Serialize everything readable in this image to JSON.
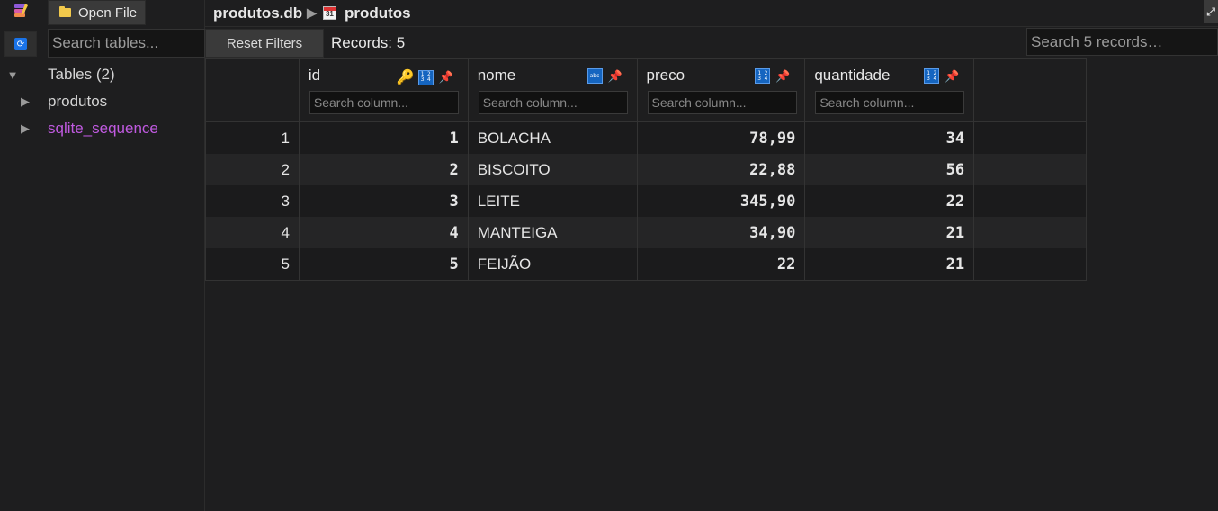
{
  "sidebar": {
    "open_file_label": "Open File",
    "search_placeholder": "Search tables...",
    "tables_label": "Tables (2)",
    "tables": [
      {
        "name": "produtos"
      },
      {
        "name": "sqlite_sequence"
      }
    ]
  },
  "breadcrumb": {
    "database": "produtos.db",
    "table": "produtos"
  },
  "toolbar": {
    "reset_label": "Reset Filters",
    "records_label": "Records: 5",
    "search_records_placeholder": "Search 5 records…"
  },
  "columns": [
    {
      "name": "id",
      "type_icon": "numeric-icon",
      "primary_key": true,
      "search_placeholder": "Search column..."
    },
    {
      "name": "nome",
      "type_icon": "text-icon",
      "primary_key": false,
      "search_placeholder": "Search column..."
    },
    {
      "name": "preco",
      "type_icon": "numeric-icon",
      "primary_key": false,
      "search_placeholder": "Search column..."
    },
    {
      "name": "quantidade",
      "type_icon": "numeric-icon",
      "primary_key": false,
      "search_placeholder": "Search column..."
    }
  ],
  "rows": [
    {
      "rownum": "1",
      "id": "1",
      "nome": "BOLACHA",
      "preco": "78,99",
      "quantidade": "34"
    },
    {
      "rownum": "2",
      "id": "2",
      "nome": "BISCOITO",
      "preco": "22,88",
      "quantidade": "56"
    },
    {
      "rownum": "3",
      "id": "3",
      "nome": "LEITE",
      "preco": "345,90",
      "quantidade": "22"
    },
    {
      "rownum": "4",
      "id": "4",
      "nome": "MANTEIGA",
      "preco": "34,90",
      "quantidade": "21"
    },
    {
      "rownum": "5",
      "id": "5",
      "nome": "FEIJÃO",
      "preco": "22",
      "quantidade": "21"
    }
  ],
  "colors": {
    "background": "#1e1e1f",
    "accent_blue": "#1565c0",
    "pin_red": "#e03c31",
    "key_gold": "#f2b632",
    "sqlite_sequence_label": "#c05ae0"
  }
}
